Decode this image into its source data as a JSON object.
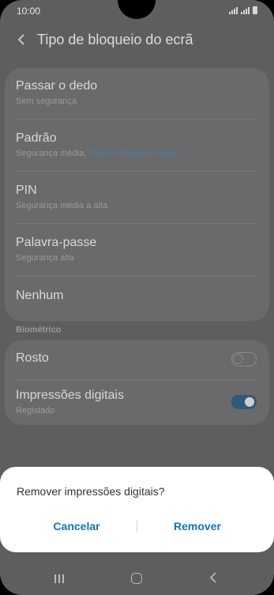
{
  "status": {
    "time": "10:00"
  },
  "header": {
    "title": "Tipo de bloqueio do ecrã"
  },
  "lock_types": [
    {
      "title": "Passar o dedo",
      "subtitle": "Sem segurança"
    },
    {
      "title": "Padrão",
      "subtitle": "Segurança média, ",
      "subtitle_link": "Tipo de bloqueio actual"
    },
    {
      "title": "PIN",
      "subtitle": "Segurança média a alta"
    },
    {
      "title": "Palavra-passe",
      "subtitle": "Segurança alta"
    },
    {
      "title": "Nenhum"
    }
  ],
  "biometrics": {
    "section_label": "Biométrico",
    "items": [
      {
        "title": "Rosto",
        "enabled": false
      },
      {
        "title": "Impressões digitais",
        "subtitle": "Registado",
        "enabled": true
      }
    ]
  },
  "dialog": {
    "message": "Remover impressões digitais?",
    "cancel_label": "Cancelar",
    "confirm_label": "Remover"
  },
  "navbar": {
    "icons": [
      "recents-icon",
      "home-icon",
      "back-icon"
    ]
  },
  "colors": {
    "accent": "#0c74c8",
    "scrim_background": "#5e5e5e"
  }
}
